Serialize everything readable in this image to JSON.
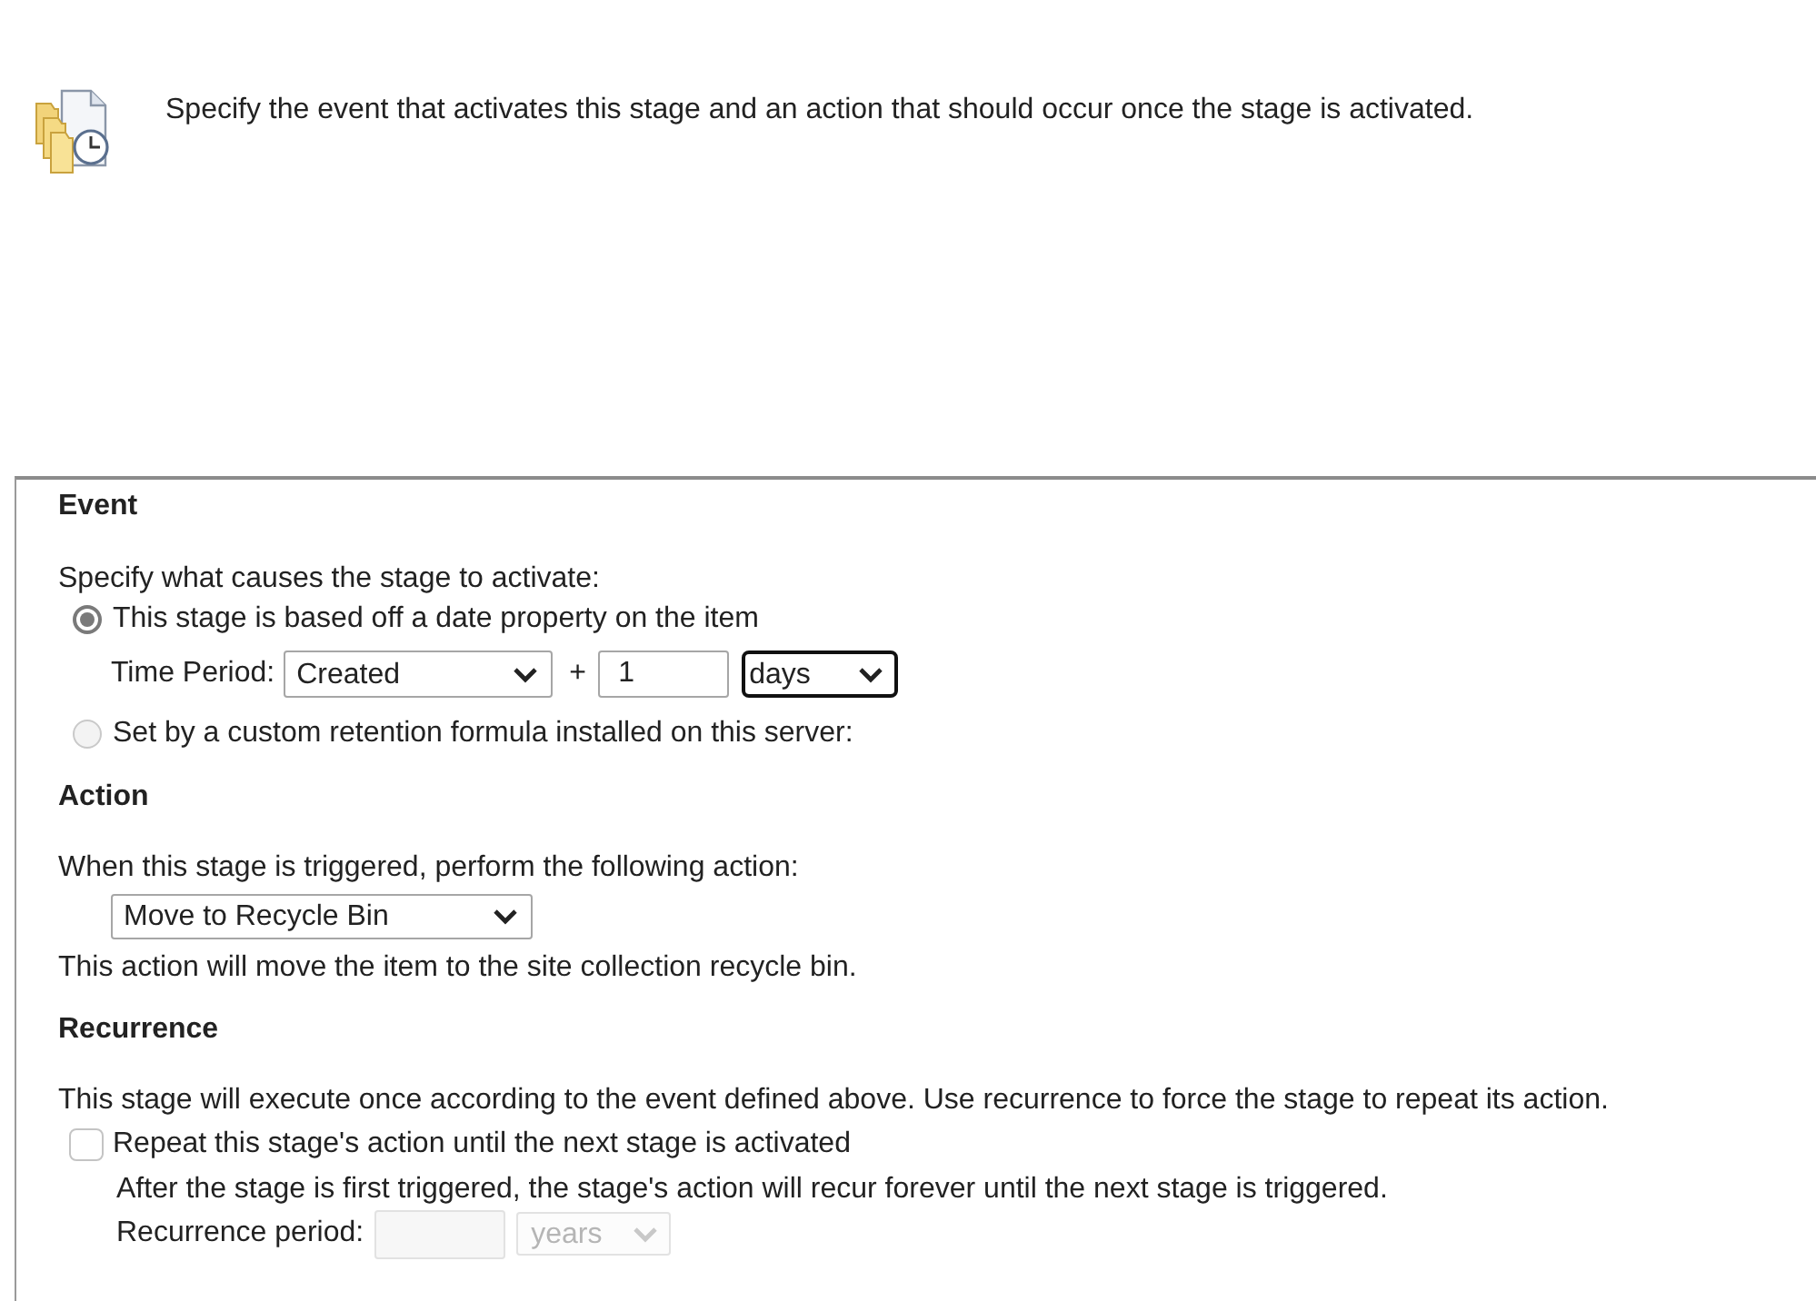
{
  "header": {
    "description": "Specify the event that activates this stage and an action that should occur once the stage is activated."
  },
  "event": {
    "title": "Event",
    "prompt": "Specify what causes the stage to activate:",
    "options": [
      {
        "label": "This stage is based off a date property on the item",
        "selected": true,
        "time_period": {
          "label": "Time Period:",
          "property": {
            "value": "Created"
          },
          "operator": "+",
          "offset": {
            "value": "1"
          },
          "unit": {
            "value": "days",
            "focused": true
          }
        }
      },
      {
        "label": "Set by a custom retention formula installed on this server:",
        "selected": false
      }
    ]
  },
  "action": {
    "title": "Action",
    "prompt": "When this stage is triggered, perform the following action:",
    "dropdown": {
      "value": "Move to Recycle Bin"
    },
    "description": "This action will move the item to the site collection recycle bin."
  },
  "recurrence": {
    "title": "Recurrence",
    "description": "This stage will execute once according to the event defined above. Use recurrence to force the stage to repeat its action.",
    "repeat": {
      "label": "Repeat this stage's action until the next stage is activated",
      "checked": false
    },
    "note": "After the stage is first triggered, the stage's action will recur forever until the next stage is triggered.",
    "period": {
      "label": "Recurrence period:",
      "amount": {
        "disabled": true
      },
      "unit": {
        "value": "years",
        "disabled": true
      }
    }
  }
}
